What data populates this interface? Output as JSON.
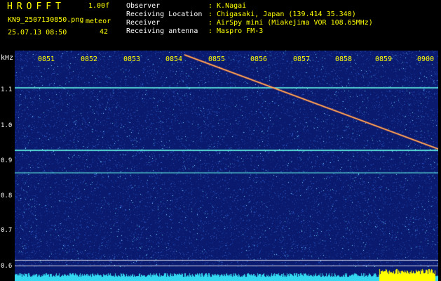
{
  "header": {
    "brand": "HROFFT",
    "version": "1.00f",
    "filename": "KN9_2507130850.png",
    "meteor_label": "meteor",
    "meteor_count": "42",
    "timestamp": "25.07.13 08:50"
  },
  "meta": [
    {
      "label": "Observer",
      "value": ": K.Nagai"
    },
    {
      "label": "Receiving Location",
      "value": ": Chigasaki, Japan (139.414 35.340)"
    },
    {
      "label": "Receiver",
      "value": ": AirSpy mini (Miakejima VOR 108.65MHz)"
    },
    {
      "label": "Receiving antenna",
      "value": ": Maspro FM-3"
    }
  ],
  "spectrogram": {
    "yaxis_label": "kHz",
    "ytick_labels": [
      "1.1",
      "1.0",
      "0.9",
      "0.8",
      "0.7",
      "0.6"
    ],
    "xtick_labels": [
      "0851",
      "0852",
      "0853",
      "0854",
      "0855",
      "0856",
      "0857",
      "0858",
      "0859",
      "0900"
    ],
    "colors": {
      "background": "#0a1a6e",
      "noise_dim": "#2a58c8",
      "noise_bright": "#6fd6ff",
      "carrier_line": "#5ef0e0",
      "meteor_trail": "#ff6a40",
      "grid_line": "#ffffff",
      "bottom_band": "#33d8f0",
      "bottom_band_hot": "#ffff00"
    }
  }
}
